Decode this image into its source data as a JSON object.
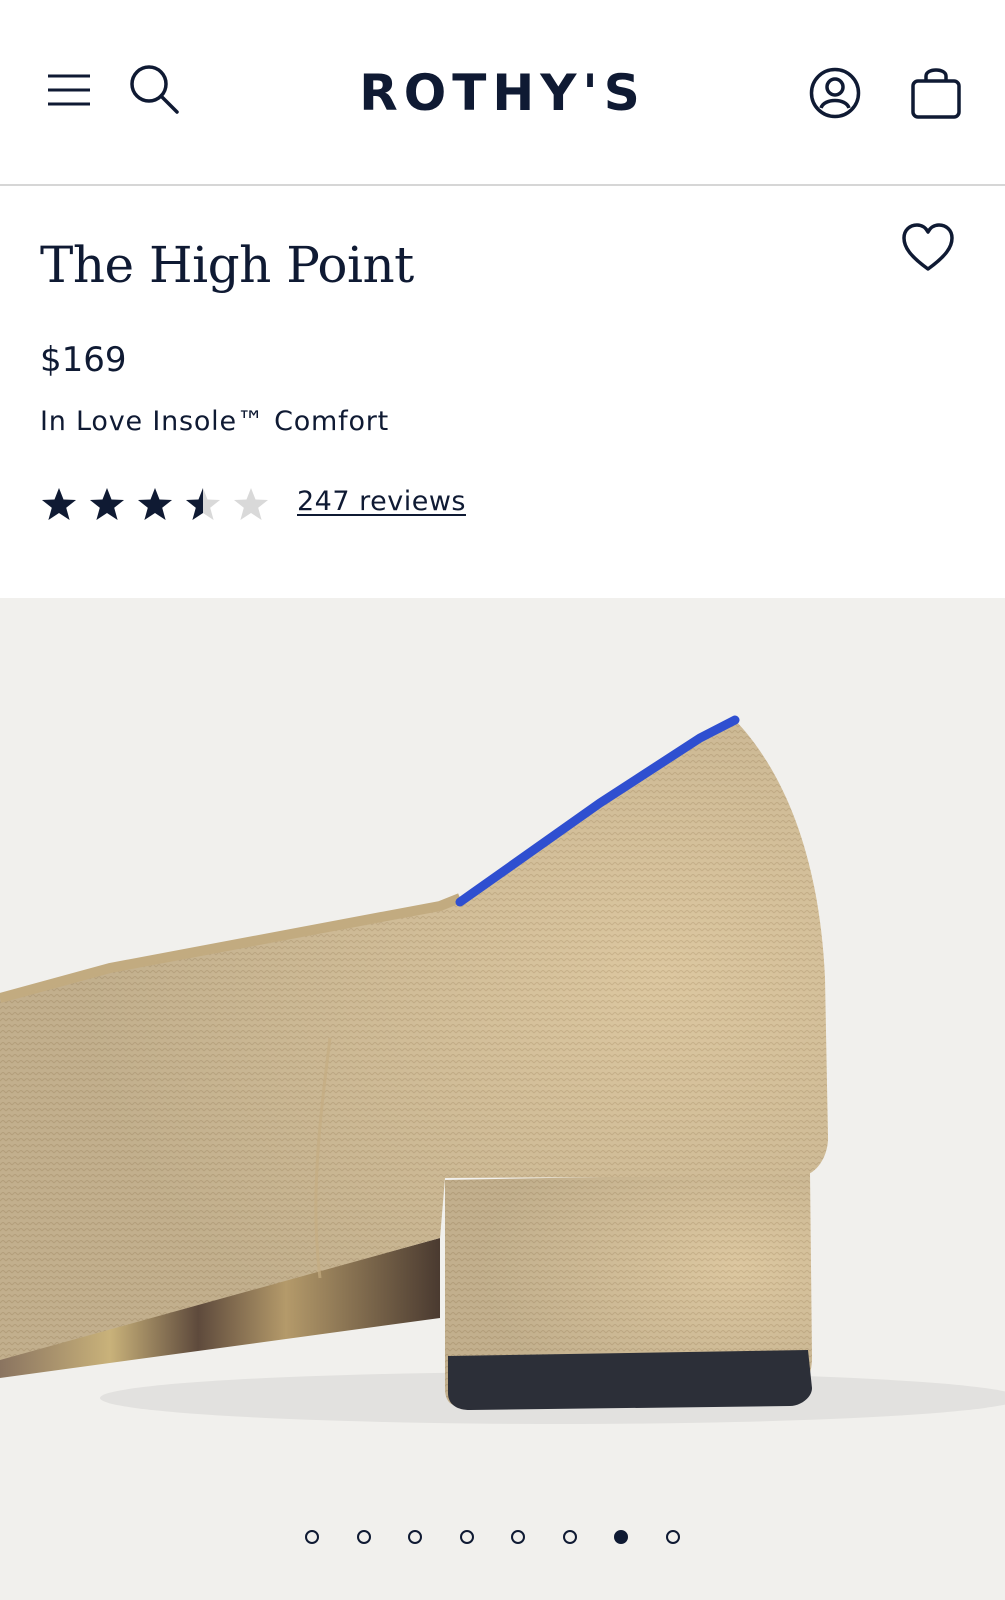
{
  "header": {
    "logo": "ROTHY'S",
    "icons": [
      "menu-icon",
      "search-icon",
      "account-icon",
      "shopping-bag-icon"
    ]
  },
  "product": {
    "title": "The High Point",
    "price": "$169",
    "subtitle": "In Love Insole™ Comfort",
    "rating": 3.5,
    "rating_max": 5,
    "reviews_label": "247 reviews",
    "favorite_icon": "heart-icon"
  },
  "gallery": {
    "image_count": 8,
    "active_index": 6
  },
  "colors": {
    "navy": "#0f1a33",
    "gallery_bg": "#f1f0ed",
    "knit_beige": "#dcc7a0",
    "trim_blue": "#2f4fd0",
    "star_empty": "#d9d9d9"
  }
}
